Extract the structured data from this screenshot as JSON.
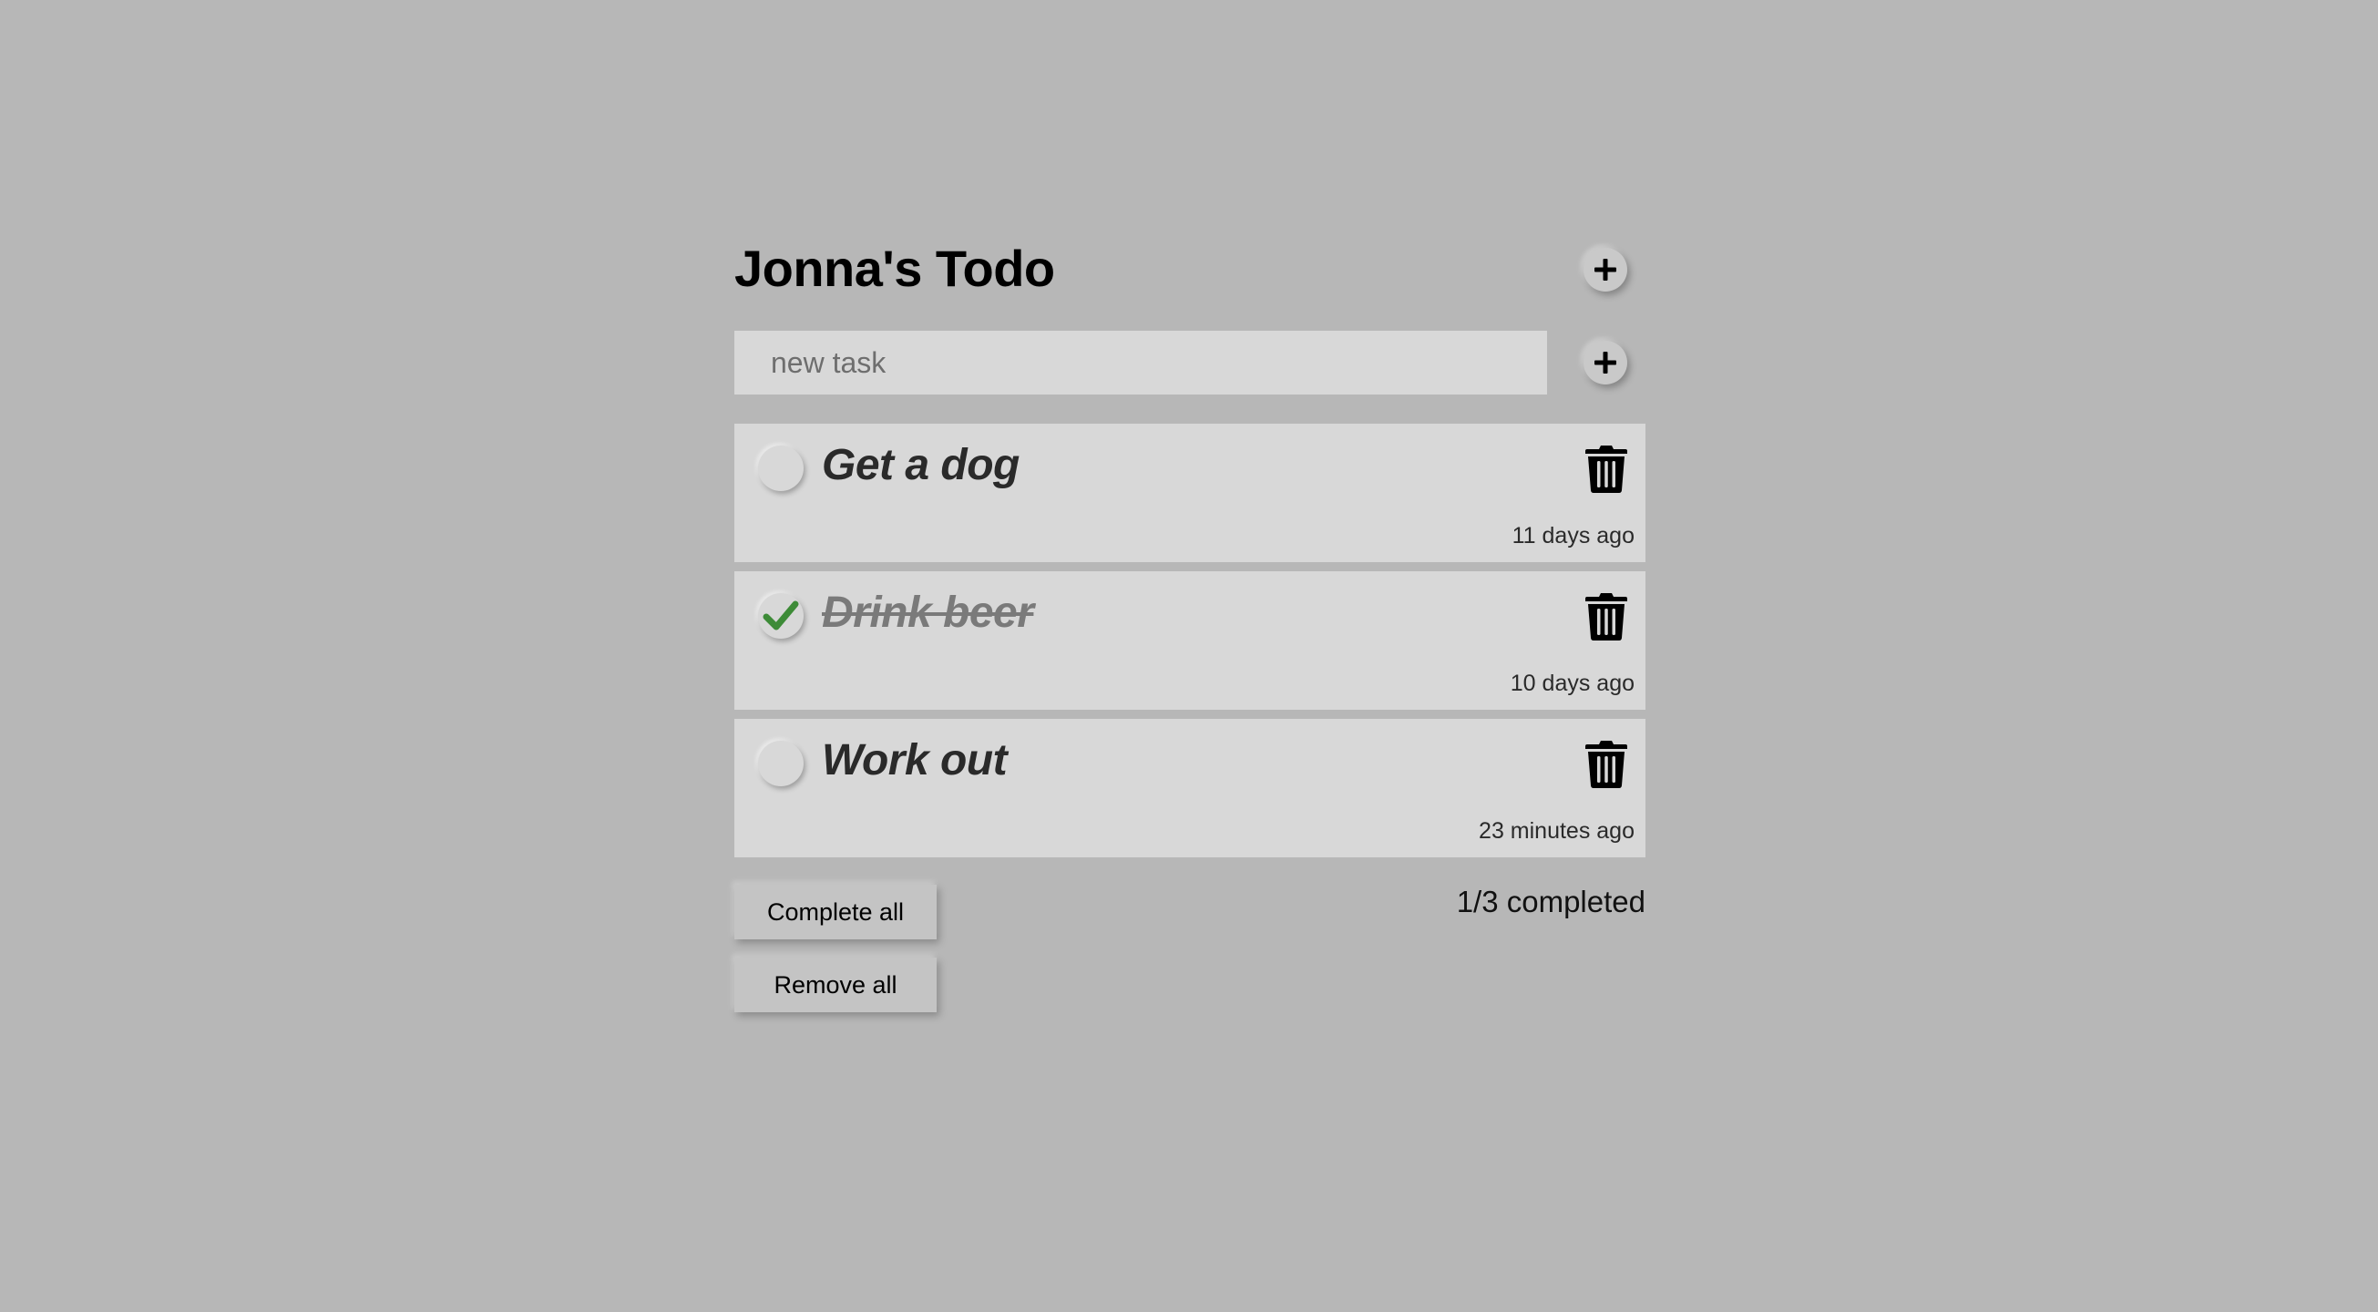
{
  "app": {
    "title": "Jonna's Todo"
  },
  "new_task": {
    "placeholder": "new task",
    "value": ""
  },
  "tasks": [
    {
      "text": "Get a dog",
      "completed": false,
      "time": "11 days ago"
    },
    {
      "text": "Drink beer",
      "completed": true,
      "time": "10 days ago"
    },
    {
      "text": "Work out",
      "completed": false,
      "time": "23 minutes ago"
    }
  ],
  "footer": {
    "complete_all_label": "Complete all",
    "remove_all_label": "Remove all",
    "progress_text": "1/3 completed"
  },
  "colors": {
    "background": "#b7b7b7",
    "card": "#d8d8d8",
    "check_green": "#3d8b37"
  },
  "icons": {
    "header_add": "plus-icon",
    "input_add": "plus-icon",
    "delete": "trash-icon",
    "checked": "checkmark-icon"
  }
}
